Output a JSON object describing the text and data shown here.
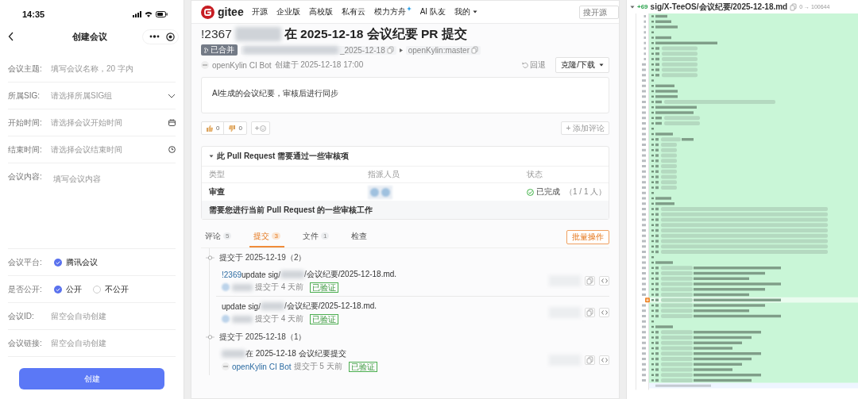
{
  "phone": {
    "status_bar": {
      "time": "14:35"
    },
    "nav": {
      "title": "创建会议"
    },
    "fields": [
      {
        "kind": "input",
        "label": "会议主题:",
        "placeholder": "填写会议名称，20 字内"
      },
      {
        "kind": "select",
        "label": "所属SIG:",
        "placeholder": "请选择所属SIG组"
      },
      {
        "kind": "date",
        "label": "开始时间:",
        "placeholder": "请选择会议开始时间"
      },
      {
        "kind": "time",
        "label": "结束时间:",
        "placeholder": "请选择会议结束时间"
      },
      {
        "kind": "textarea",
        "label": "会议内容:",
        "placeholder": "填写会议内容"
      },
      {
        "kind": "radio",
        "label": "会议平台:",
        "options": [
          {
            "label": "腾讯会议",
            "selected": true
          }
        ]
      },
      {
        "kind": "radio",
        "label": "是否公开:",
        "options": [
          {
            "label": "公开",
            "selected": true
          },
          {
            "label": "不公开",
            "selected": false
          }
        ]
      },
      {
        "kind": "input",
        "label": "会议ID:",
        "placeholder": "留空会自动创建"
      },
      {
        "kind": "input",
        "label": "会议链接:",
        "placeholder": "留空会自动创建"
      }
    ],
    "submit": "创建"
  },
  "gitee": {
    "logo": "gitee",
    "nav": [
      {
        "label": "开源",
        "kind": "link"
      },
      {
        "label": "企业版",
        "kind": "link"
      },
      {
        "label": "高校版",
        "kind": "link"
      },
      {
        "label": "私有云",
        "kind": "link"
      },
      {
        "label": "模力方舟",
        "kind": "sparkle"
      },
      {
        "label": "AI 队友",
        "kind": "link"
      },
      {
        "label": "我的",
        "kind": "dropdown"
      }
    ],
    "search": {
      "placeholder": "搜开源"
    },
    "pr": {
      "number": "!2367",
      "title": "在 2025-12-18 会议纪要 PR 提交",
      "status": "已合并",
      "source_branch": "_2025-12-18",
      "target_branch": "openKylin:master",
      "author": "openKylin CI Bot",
      "created": "创建于 2025-12-18 17:00",
      "revert": "回退",
      "clone": "克隆/下载",
      "description": "AI生成的会议纪要，审核后进行同步",
      "reactions": [
        {
          "kind": "up",
          "count": "0"
        },
        {
          "kind": "down",
          "count": "0"
        }
      ],
      "add_comment": "+ 添加评论"
    },
    "review": {
      "title": "此 Pull Request 需要通过一些审核项",
      "columns": [
        "类型",
        "指派人员",
        "状态"
      ],
      "rows": [
        {
          "type": "审查",
          "done": true,
          "status": "已完成",
          "progress": "（1 / 1 人）"
        }
      ],
      "note": "需要您进行当前 Pull Request 的一些审核工作"
    },
    "tabs": [
      {
        "label": "评论",
        "count": "5",
        "selected": false
      },
      {
        "label": "提交",
        "count": "3",
        "selected": true
      },
      {
        "label": "文件",
        "count": "1",
        "selected": false
      },
      {
        "label": "检查",
        "selected": false
      }
    ],
    "batch": "批量操作",
    "commit_groups": [
      {
        "title": "提交于 2025-12-19（2）",
        "commits": [
          {
            "message": [
              {
                "kind": "link",
                "text": "!2369"
              },
              {
                "kind": "text",
                "text": "update sig/"
              },
              {
                "kind": "blur"
              },
              {
                "kind": "text",
                "text": "/会议纪要/2025-12-18.md."
              }
            ],
            "author": {
              "kind": "blur"
            },
            "time": "提交于 4 天前",
            "verified": "已验证"
          },
          {
            "message": [
              {
                "kind": "text",
                "text": "update sig/"
              },
              {
                "kind": "blur"
              },
              {
                "kind": "text",
                "text": "/会议纪要/2025-12-18.md."
              }
            ],
            "author": {
              "kind": "blur"
            },
            "time": "提交于 4 天前",
            "verified": "已验证"
          }
        ]
      },
      {
        "title": "提交于 2025-12-18（1）",
        "commits": [
          {
            "message": [
              {
                "kind": "blur"
              },
              {
                "kind": "text",
                "text": "在 2025-12-18 会议纪要提交"
              }
            ],
            "author": {
              "kind": "link",
              "text": "openKylin CI Bot"
            },
            "time": "提交于 5 天前",
            "verified": "已验证"
          }
        ]
      }
    ]
  },
  "diff": {
    "added": "+69",
    "path": "sig/X-TeeOS/会议纪要/2025-12-18.md",
    "mode": "0 → 100644"
  }
}
